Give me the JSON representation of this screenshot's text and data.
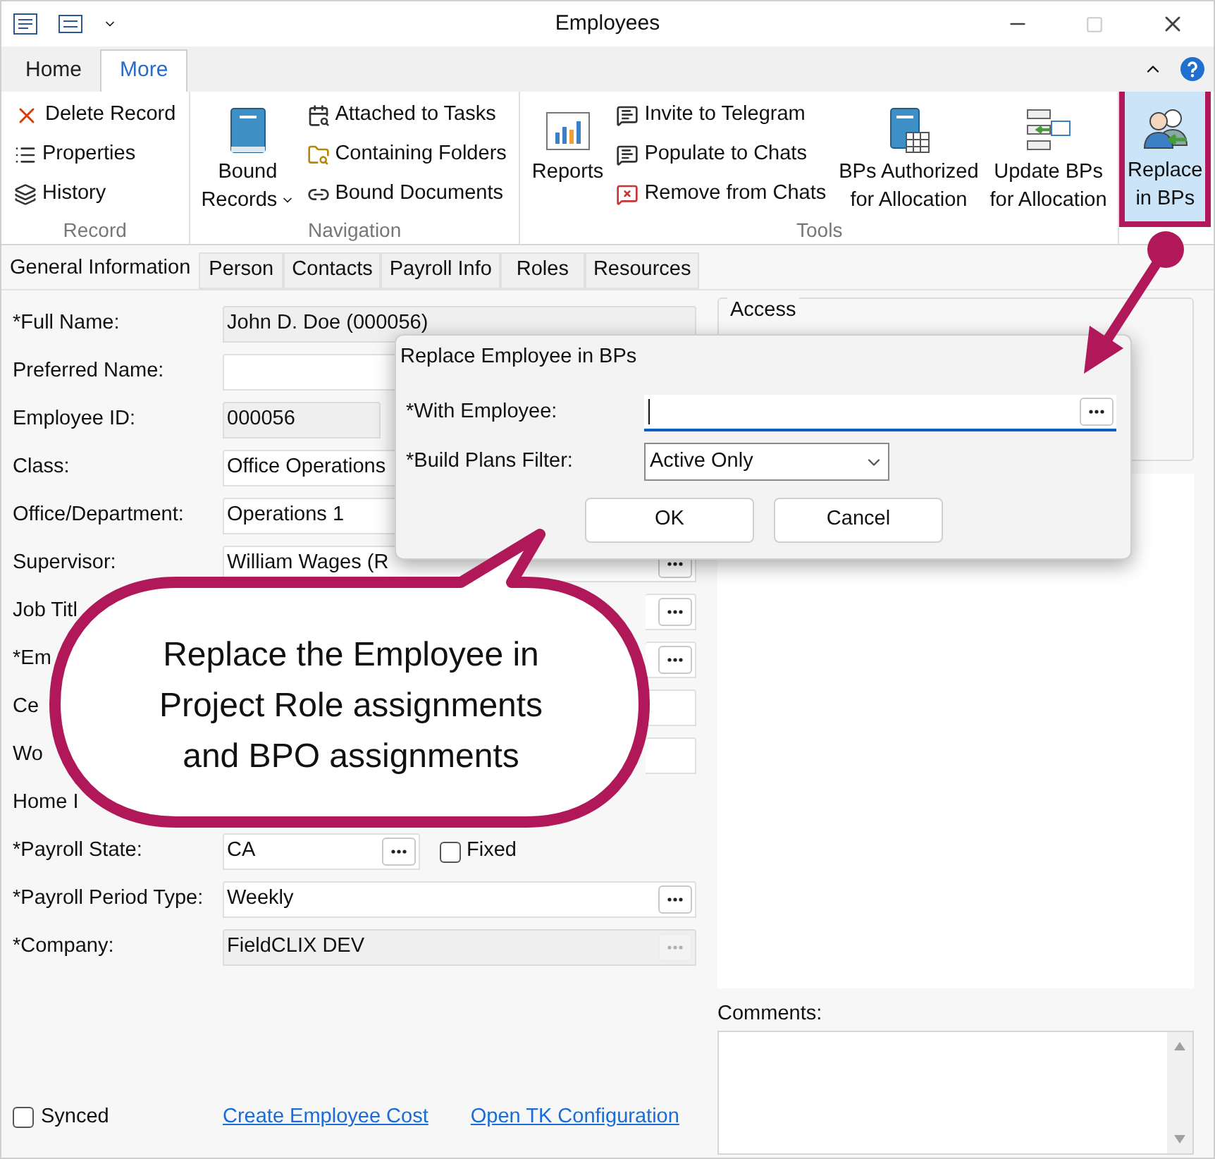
{
  "window": {
    "title": "Employees"
  },
  "ribbon_tabs": [
    {
      "label": "Home",
      "selected": false
    },
    {
      "label": "More",
      "selected": true
    }
  ],
  "ribbon_groups": [
    {
      "label": "Record",
      "items": [
        {
          "kind": "small",
          "label": "Delete Record"
        },
        {
          "kind": "small",
          "label": "Properties"
        },
        {
          "kind": "small",
          "label": "History"
        }
      ]
    },
    {
      "label": "Navigation",
      "items": [
        {
          "kind": "large",
          "lines": [
            "Bound",
            "Records"
          ],
          "dropdown": true
        },
        {
          "kind": "small",
          "label": "Attached to Tasks"
        },
        {
          "kind": "small",
          "label": "Containing Folders"
        },
        {
          "kind": "small",
          "label": "Bound Documents"
        }
      ]
    },
    {
      "label": "Tools",
      "items": [
        {
          "kind": "large",
          "lines": [
            "Reports"
          ],
          "dropdown": false
        },
        {
          "kind": "small",
          "label": "Invite to Telegram"
        },
        {
          "kind": "small",
          "label": "Populate to Chats"
        },
        {
          "kind": "small",
          "label": "Remove from Chats"
        },
        {
          "kind": "large",
          "lines": [
            "BPs Authorized",
            "for Allocation"
          ],
          "dropdown": false
        },
        {
          "kind": "large",
          "lines": [
            "Update BPs",
            "for Allocation"
          ],
          "dropdown": false
        }
      ]
    }
  ],
  "replace_button": {
    "lines": [
      "Replace",
      "in BPs"
    ],
    "selected": true,
    "annotated": true
  },
  "form_tabs": [
    {
      "label": "General Information",
      "selected": true
    },
    {
      "label": "Person",
      "selected": false
    },
    {
      "label": "Contacts",
      "selected": false
    },
    {
      "label": "Payroll Info",
      "selected": false
    },
    {
      "label": "Roles",
      "selected": false
    },
    {
      "label": "Resources",
      "selected": false
    }
  ],
  "fields": [
    {
      "label": "*Full Name:",
      "kind": "readonly",
      "value": "John D. Doe (000056)"
    },
    {
      "label": "Preferred Name:",
      "kind": "text"
    },
    {
      "label": "Employee ID:",
      "kind": "short_readonly",
      "value": "000056"
    },
    {
      "label": "Class:",
      "kind": "text",
      "value": "Office Operations"
    },
    {
      "label": "Office/Department:",
      "kind": "text",
      "value": "Operations 1"
    },
    {
      "label": "Supervisor:",
      "kind": "lookup",
      "value": "William Wages (R"
    },
    {
      "label": "Job Titl",
      "kind": "lookup",
      "covered": true
    },
    {
      "label": "*Em",
      "kind": "lookup",
      "covered": true
    },
    {
      "label": "Ce",
      "kind": "text",
      "covered": true
    },
    {
      "label": "Wo",
      "kind": "text",
      "covered": true
    },
    {
      "label": "Home I",
      "kind": "none"
    },
    {
      "label": "*Payroll State:",
      "kind": "short_lookup",
      "value": "CA",
      "checkbox": {
        "label": "Fixed",
        "checked": false
      }
    },
    {
      "label": "*Payroll Period Type:",
      "kind": "lookup",
      "value": "Weekly"
    },
    {
      "label": "*Company:",
      "kind": "lookup_readonly",
      "value": "FieldCLIX DEV"
    }
  ],
  "synced": {
    "label": "Synced",
    "checked": false
  },
  "links": [
    "Create Employee Cost",
    "Open TK Configuration"
  ],
  "access": {
    "title": "Access"
  },
  "comments": {
    "label": "Comments:"
  },
  "dialog": {
    "title": "Replace Employee in BPs",
    "with_employee": {
      "label": "*With Employee:"
    },
    "filter": {
      "label": "*Build Plans Filter:",
      "value": "Active Only"
    },
    "buttons": [
      "OK",
      "Cancel"
    ]
  },
  "callout": {
    "text": "Replace the Employee in Project Role assignments and BPO assignments"
  }
}
